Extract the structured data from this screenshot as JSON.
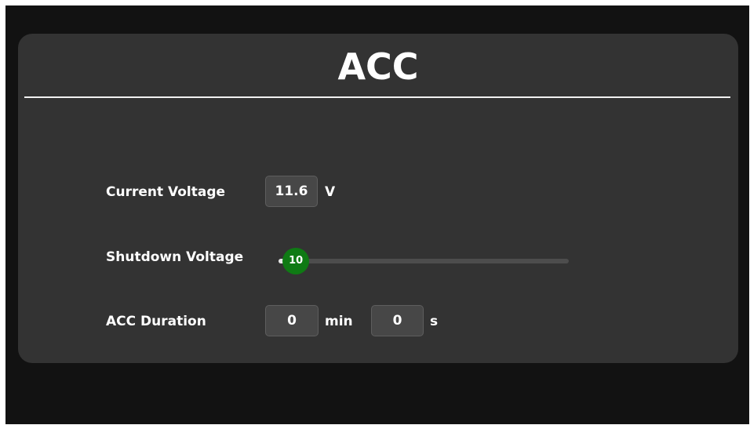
{
  "title": "ACC",
  "current_voltage": {
    "label": "Current Voltage",
    "value": "11.6",
    "unit": "V"
  },
  "shutdown_voltage": {
    "label": "Shutdown Voltage",
    "value": "10",
    "fraction": 0.06
  },
  "acc_duration": {
    "label": "ACC Duration",
    "minutes": "0",
    "minutes_unit": "min",
    "seconds": "0",
    "seconds_unit": "s"
  },
  "colors": {
    "background": "#121212",
    "panel": "#333333",
    "slider_thumb": "#0f7a14",
    "text": "#ffffff"
  }
}
